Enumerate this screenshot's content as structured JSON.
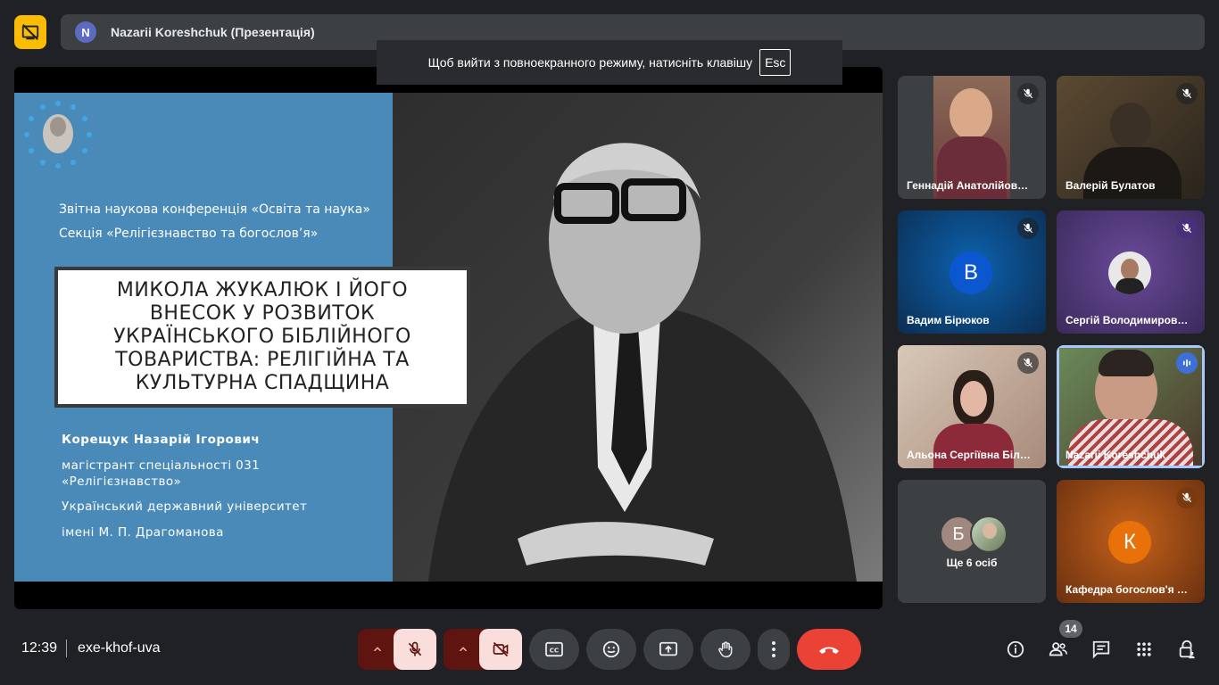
{
  "presenter": {
    "avatar_letter": "N",
    "name": "Nazarii Koreshchuk (Презентація)"
  },
  "toast": {
    "text": "Щоб вийти з повноекранного режиму, натисніть клавішу",
    "key": "Esc"
  },
  "slide": {
    "conference": "Звітна наукова конференція «Освіта та наука»",
    "section": "Секція «Релігієзнавство та богослов’я»",
    "title": "МИКОЛА ЖУКАЛЮК І ЙОГО ВНЕСОК У РОЗВИТОК УКРАЇНСЬКОГО БІБЛІЙНОГО ТОВАРИСТВА: РЕЛІГІЙНА ТА КУЛЬТУРНА СПАДЩИНА",
    "author": "Корещук Назарій Ігорович",
    "degree_line1": "магістрант спеціальності 031",
    "degree_line2": "«Релігієзнавство»",
    "university_line1": "Український державний університет",
    "university_line2": "імені М. П. Драгоманова"
  },
  "participants": [
    {
      "name": "Геннадій Анатолійов…",
      "muted": true
    },
    {
      "name": "Валерій Булатов",
      "muted": true
    },
    {
      "name": "Вадим Бірюков",
      "avatar": "В",
      "muted": true
    },
    {
      "name": "Сергій Володимиров…",
      "muted": true
    },
    {
      "name": "Альона Сергіївна Біл…",
      "muted": true
    },
    {
      "name": "Nazarii Koreshchuk",
      "speaking": true
    },
    {
      "name": "Ще 6 осіб",
      "avatar": "Б"
    },
    {
      "name": "Кафедра богослов'я …",
      "avatar": "К",
      "muted": true
    }
  ],
  "bottom": {
    "time": "12:39",
    "meeting_code": "exe-khof-uva",
    "people_count": "14"
  },
  "colors": {
    "accent_red": "#ea4335",
    "mic_off_bg": "#f9dedc",
    "chevron_bg": "#601410",
    "slide_blue": "#4a8ab8",
    "present_yellow": "#fbbc04"
  }
}
